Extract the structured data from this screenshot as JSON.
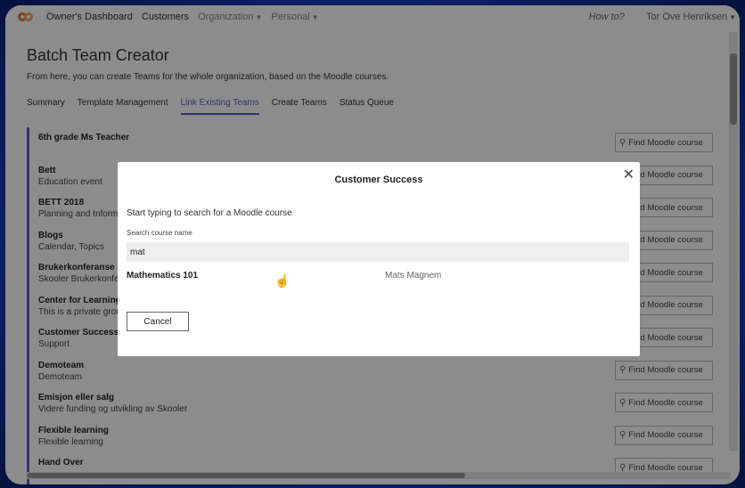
{
  "nav": {
    "items": [
      "Owner's Dashboard",
      "Customers"
    ],
    "dropdowns": [
      "Organization",
      "Personal"
    ],
    "howto": "How to?",
    "user": "Tor Ove Henriksen"
  },
  "page": {
    "title": "Batch Team Creator",
    "subtitle": "From here, you can create Teams for the whole organization, based on the Moodle courses.",
    "tabs": [
      "Summary",
      "Template Management",
      "Link Existing Teams",
      "Create Teams",
      "Status Queue"
    ],
    "active_tab": "Link Existing Teams"
  },
  "teams": [
    {
      "name": "6th grade Ms Teacher",
      "desc": ""
    },
    {
      "name": "Bett",
      "desc": "Education event"
    },
    {
      "name": "BETT 2018",
      "desc": "Planning and Information"
    },
    {
      "name": "Blogs",
      "desc": "Calendar, Topics"
    },
    {
      "name": "Brukerkonferanse",
      "desc": "Skooler Brukerkonferanse"
    },
    {
      "name": "Center for Learning",
      "desc": "This is a private group"
    },
    {
      "name": "Customer Success",
      "desc": "Support"
    },
    {
      "name": "Demoteam",
      "desc": "Demoteam"
    },
    {
      "name": "Emisjon eller salg",
      "desc": "Videre funding og utvikling av Skooler"
    },
    {
      "name": "Flexible learning",
      "desc": "Flexible learning"
    },
    {
      "name": "Hand Over",
      "desc": ""
    }
  ],
  "find_button_label": "Find Moodle course",
  "modal": {
    "title": "Customer Success",
    "prompt": "Start typing to search for a Moodle course",
    "field_label": "Search course name",
    "search_value": "mat",
    "result": {
      "name": "Mathematics 101",
      "owner": "Mats Magnem"
    },
    "cancel_label": "Cancel"
  },
  "colors": {
    "accent": "#5b5fc7",
    "logo": "#e8743b"
  }
}
